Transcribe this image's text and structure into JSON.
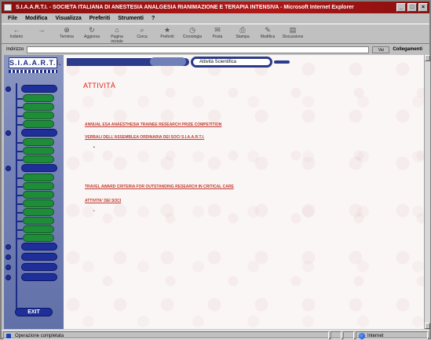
{
  "window": {
    "title": "S.I.A.A.R.T.I. - SOCIETA ITALIANA DI ANESTESIA ANALGESIA RIANIMAZIONE E TERAPIA INTENSIVA - Microsoft Internet Explorer"
  },
  "menubar": {
    "items": [
      "File",
      "Modifica",
      "Visualizza",
      "Preferiti",
      "Strumenti",
      "?"
    ]
  },
  "toolbar": {
    "buttons": [
      {
        "label": "Indietro",
        "icon": "back-arrow-icon"
      },
      {
        "label": "",
        "icon": "forward-arrow-icon"
      },
      {
        "label": "Termina",
        "icon": "stop-icon"
      },
      {
        "label": "Aggiorna",
        "icon": "refresh-icon"
      },
      {
        "label": "Pagina iniziale",
        "icon": "home-icon"
      },
      {
        "label": "Cerca",
        "icon": "search-icon"
      },
      {
        "label": "Preferiti",
        "icon": "favorites-icon"
      },
      {
        "label": "Cronologia",
        "icon": "history-icon"
      },
      {
        "label": "Posta",
        "icon": "mail-icon"
      },
      {
        "label": "Stampa",
        "icon": "print-icon"
      },
      {
        "label": "Modifica",
        "icon": "edit-icon"
      },
      {
        "label": "Discussione",
        "icon": "discuss-icon"
      }
    ]
  },
  "addressbar": {
    "label": "Indirizzo",
    "url": "",
    "go_label": "Vai",
    "links_label": "Collegamenti"
  },
  "leftnav": {
    "logo": "S.I.A.A.R.T.I.",
    "top_links": [
      "",
      ""
    ],
    "items": [
      "",
      "",
      "",
      "",
      "",
      "",
      "",
      "",
      "",
      "",
      "",
      "",
      "",
      "",
      "",
      "",
      "",
      "",
      "",
      "",
      "",
      ""
    ],
    "exit_label": "EXIT"
  },
  "content": {
    "breadcrumb": "",
    "breadcrumb_tab": "",
    "section_pill": "Attività Scientifica",
    "page_title": "ATTIVITÀ",
    "intro": "",
    "intro_link": "",
    "sections": [
      {
        "heading": "ANNUAL ESA ANAESTHESIA TRAINEE RESEARCH PRIZE COMPETITION",
        "items": []
      },
      {
        "heading": "VERBALI DELL'ASSEMBLEA ORDINARIA DEI SOCI S.I.A.A.R.T.I.",
        "items": [
          "",
          "",
          "",
          "",
          ""
        ]
      },
      {
        "heading": "TRAVEL AWARD CRITERIA FOR OUTSTANDING RESEARCH IN CRITICAL CARE",
        "items": []
      },
      {
        "heading": "ATTIVITA' DEI SOCI",
        "items": [
          ""
        ]
      }
    ]
  },
  "statusbar": {
    "left": "Operazione completata",
    "zone": "Internet"
  }
}
